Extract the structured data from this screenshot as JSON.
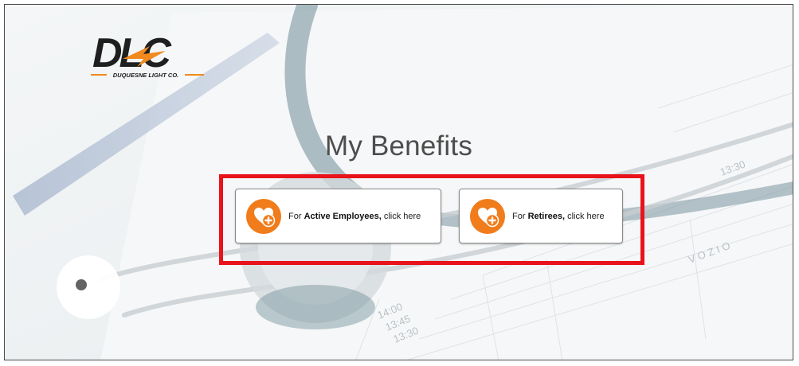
{
  "brand": {
    "logo_text": "DLC",
    "logo_subtext": "DUQUESNE LIGHT CO."
  },
  "page": {
    "title": "My Benefits"
  },
  "options": [
    {
      "prefix": "For ",
      "bold": "Active Employees,",
      "suffix": " click here",
      "icon": "heart-plus-icon"
    },
    {
      "prefix": "For ",
      "bold": "Retirees,",
      "suffix": " click here",
      "icon": "heart-plus-icon"
    }
  ],
  "colors": {
    "accent_orange": "#f07c1b",
    "highlight_red": "#e8131b",
    "title_gray": "#4d4d4d"
  }
}
